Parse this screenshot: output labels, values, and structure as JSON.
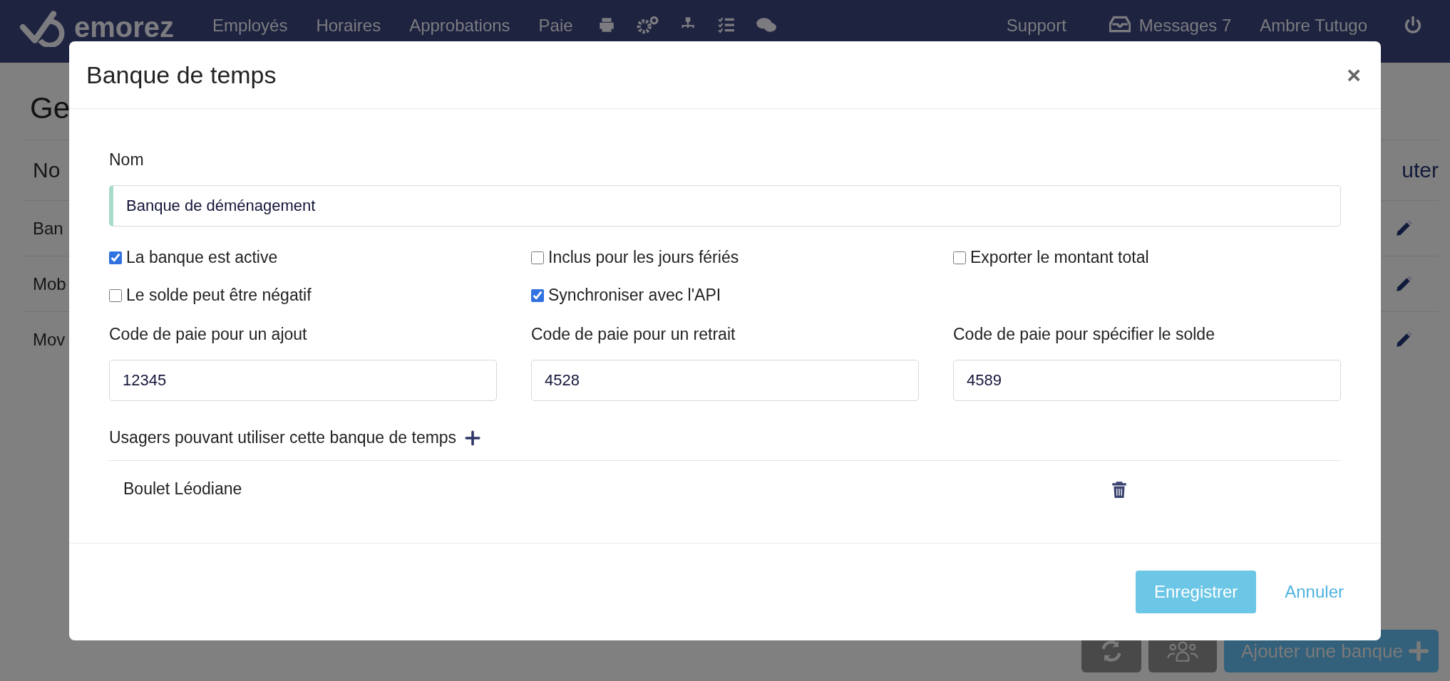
{
  "nav": {
    "brand": "emorez",
    "links": [
      "Employés",
      "Horaires",
      "Approbations",
      "Paie"
    ],
    "support": "Support",
    "messages": "Messages 7",
    "user": "Ambre Tutugo"
  },
  "page": {
    "title": "Ge",
    "column_1": "No",
    "column_2": "uter",
    "rows": [
      "Ban",
      "Mob",
      "Mov"
    ],
    "add_button": "Ajouter une banque"
  },
  "modal": {
    "title": "Banque de temps",
    "close": "×",
    "name_label": "Nom",
    "name_value": "Banque de déménagement",
    "checkboxes": [
      {
        "label": "La banque est active",
        "checked": true
      },
      {
        "label": "Inclus pour les jours fériés",
        "checked": false
      },
      {
        "label": "Exporter le montant total",
        "checked": false
      },
      {
        "label": "Le solde peut être négatif",
        "checked": false
      },
      {
        "label": "Synchroniser avec l'API",
        "checked": true
      }
    ],
    "codes": [
      {
        "label": "Code de paie pour un ajout",
        "value": "12345"
      },
      {
        "label": "Code de paie pour un retrait",
        "value": "4528"
      },
      {
        "label": "Code de paie pour spécifier le solde",
        "value": "4589"
      }
    ],
    "users_label": "Usagers pouvant utiliser cette banque de temps",
    "users": [
      "Boulet Léodiane"
    ],
    "save": "Enregistrer",
    "cancel": "Annuler"
  }
}
